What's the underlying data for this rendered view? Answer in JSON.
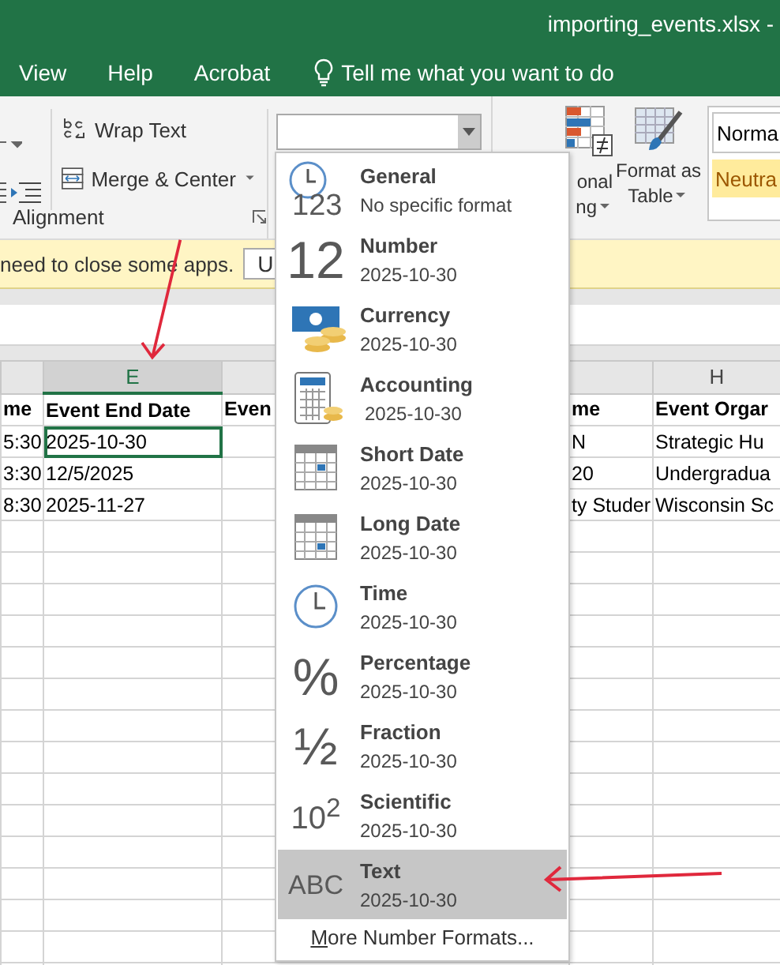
{
  "window": {
    "title": "importing_events.xlsx -"
  },
  "menu": [
    {
      "label": "View"
    },
    {
      "label": "Help"
    },
    {
      "label": "Acrobat"
    }
  ],
  "tell_me": "Tell me what you want to do",
  "ribbon": {
    "wrap_text": "Wrap Text",
    "merge_center": "Merge & Center",
    "alignment_label": "Alignment",
    "conditional_formatting": [
      "onal",
      "ng"
    ],
    "format_as_table": [
      "Format as",
      "Table"
    ],
    "styles": [
      {
        "label": "Norma",
        "kind": "normal"
      },
      {
        "label": "Neutra",
        "kind": "neutral"
      }
    ]
  },
  "message_bar": {
    "text": "need to close some apps.",
    "button": "U"
  },
  "sheet": {
    "columns": [
      {
        "selected": false
      },
      {
        "header": "E",
        "selected": true
      },
      {
        "selected": false
      },
      {
        "selected": false
      },
      {
        "header": "H",
        "selected": false
      }
    ],
    "rows": [
      [
        {
          "text": "me",
          "selected": false
        },
        {
          "text": "Event End Date",
          "selected": false
        },
        {
          "text": "Even",
          "selected": false
        },
        {
          "text": "me",
          "selected": false
        },
        {
          "text": "Event Orgar",
          "selected": false
        }
      ],
      [
        {
          "text": "5:30",
          "selected": false
        },
        {
          "text": "2025-10-30",
          "selected": true
        },
        {
          "selected": false
        },
        {
          "text": "N",
          "selected": false
        },
        {
          "text": "Strategic Hu",
          "selected": false
        }
      ],
      [
        {
          "text": "3:30",
          "selected": false
        },
        {
          "text": "12/5/2025",
          "selected": false
        },
        {
          "selected": false
        },
        {
          "text": "20",
          "selected": false
        },
        {
          "text": "Undergradua",
          "selected": false
        }
      ],
      [
        {
          "text": "8:30",
          "selected": false
        },
        {
          "text": "2025-11-27",
          "selected": false
        },
        {
          "selected": false
        },
        {
          "text": "ty Studer",
          "selected": false
        },
        {
          "text": "Wisconsin Sc",
          "selected": false
        }
      ]
    ]
  },
  "format_menu": {
    "items": [
      {
        "kind": "general",
        "glyph": "123",
        "name": "General",
        "sample": "No specific format",
        "selected": false
      },
      {
        "kind": "number",
        "glyph": "12",
        "name": "Number",
        "sample": "2025-10-30",
        "selected": false
      },
      {
        "kind": "currency",
        "name": "Currency",
        "sample": "2025-10-30",
        "selected": false
      },
      {
        "kind": "accounting",
        "name": "Accounting",
        "sample": "2025-10-30",
        "selected": false
      },
      {
        "kind": "short_date",
        "name": "Short Date",
        "sample": "2025-10-30",
        "selected": false
      },
      {
        "kind": "long_date",
        "name": "Long Date",
        "sample": "2025-10-30",
        "selected": false
      },
      {
        "kind": "time",
        "name": "Time",
        "sample": "2025-10-30",
        "selected": false
      },
      {
        "kind": "percentage",
        "glyph": "%",
        "name": "Percentage",
        "sample": "2025-10-30",
        "selected": false
      },
      {
        "kind": "fraction",
        "glyph": "½",
        "name": "Fraction",
        "sample": "2025-10-30",
        "selected": false
      },
      {
        "kind": "scientific",
        "glyph": "10$^{2}$",
        "name": "Scientific",
        "sample": "2025-10-30",
        "selected": false
      },
      {
        "kind": "text",
        "glyph": "ABC",
        "name": "Text",
        "sample": "2025-10-30",
        "selected": true
      }
    ],
    "more": "More Number Formats..."
  }
}
